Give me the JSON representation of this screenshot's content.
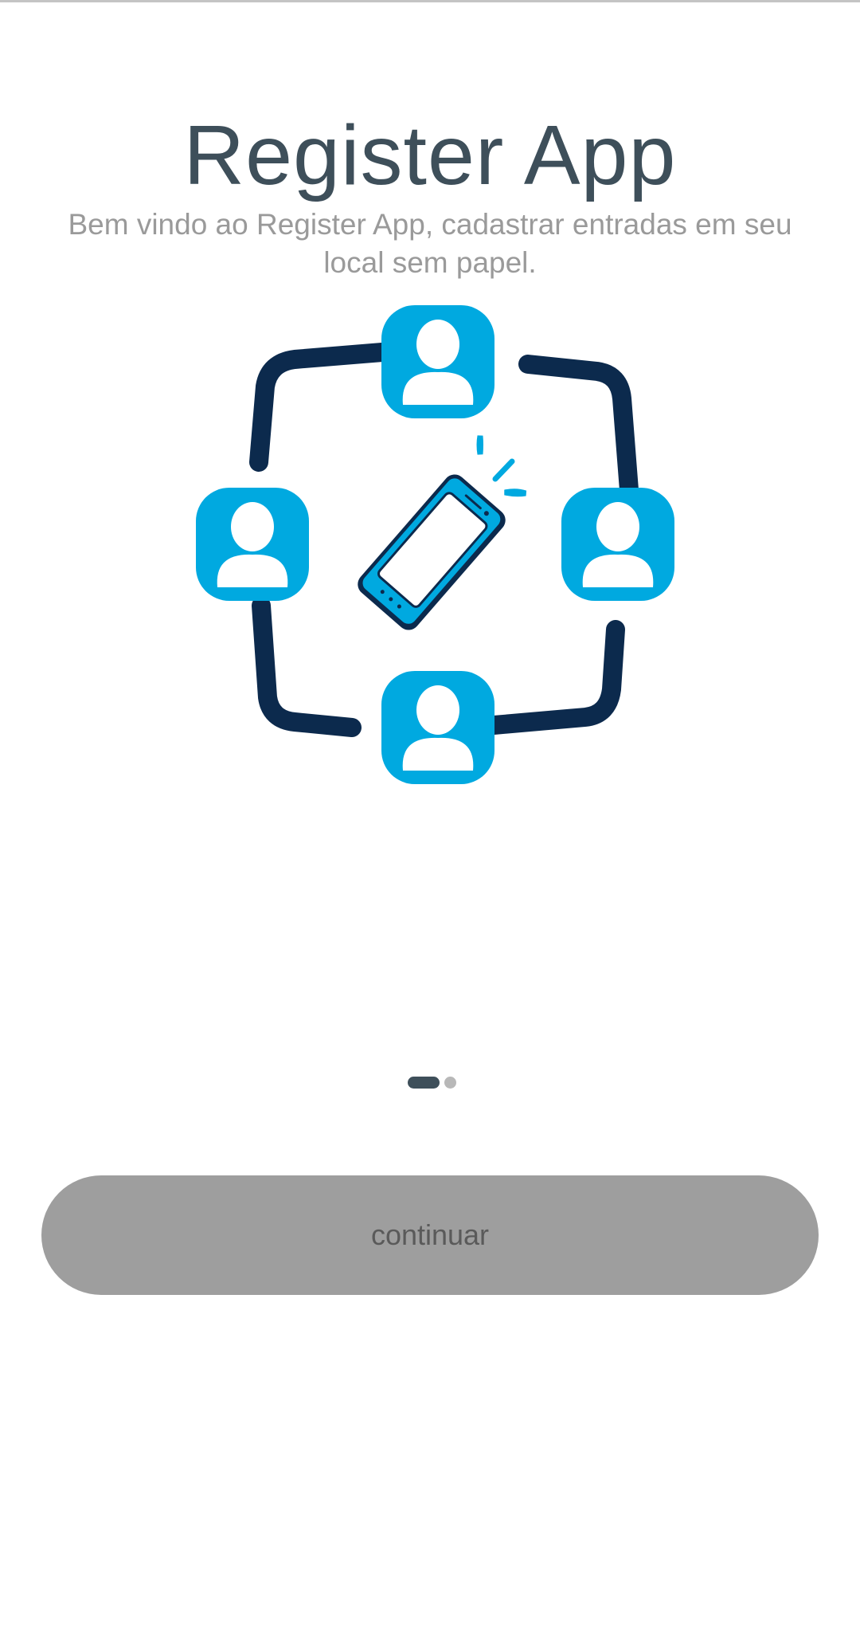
{
  "app": {
    "title": "Register App",
    "subtitle": "Bem vindo ao Register App, cadastrar entradas em seu local sem papel."
  },
  "illustration": {
    "icons": [
      "user-icon",
      "user-icon",
      "user-icon",
      "user-icon",
      "smartphone-icon"
    ],
    "colors": {
      "accent": "#00a9e0",
      "frame": "#0c2a4d"
    }
  },
  "pager": {
    "total_pages": 2,
    "current_page": 1
  },
  "actions": {
    "continue_label": "continuar"
  },
  "colors": {
    "title": "#3e4f5a",
    "subtitle": "#9a9a9a",
    "button_bg": "#9e9e9e",
    "button_text": "#5a5a5a"
  }
}
